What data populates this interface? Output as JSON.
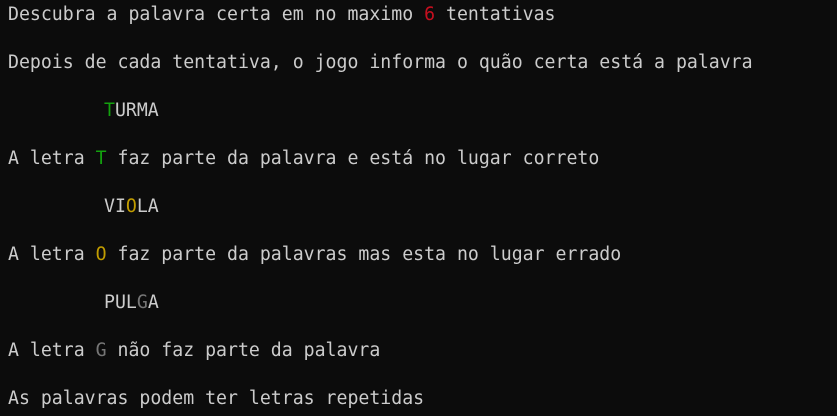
{
  "intro": {
    "line1_before": "Descubra a palavra certa em no maximo ",
    "line1_number": "6",
    "line1_after": " tentativas",
    "line2": "Depois de cada tentativa, o jogo informa o quão certa está a palavra"
  },
  "examples": [
    {
      "word_parts": [
        "",
        "T",
        "URMA"
      ],
      "explanation_before": "A letra ",
      "letter": "T",
      "explanation_after": " faz parte da palavra e está no lugar correto"
    },
    {
      "word_parts": [
        "VI",
        "O",
        "LA"
      ],
      "explanation_before": "A letra ",
      "letter": "O",
      "explanation_after": " faz parte da palavras mas esta no lugar errado"
    },
    {
      "word_parts": [
        "PUL",
        "G",
        "A"
      ],
      "explanation_before": "A letra ",
      "letter": "G",
      "explanation_after": " não faz parte da palavra"
    }
  ],
  "footer": "As palavras podem ter letras repetidas",
  "colors": {
    "background": "#0c0c0c",
    "text": "#cccccc",
    "attempts_number": "#c50f1f",
    "correct_place": "#13a10e",
    "wrong_place": "#c19c00",
    "not_in_word": "#767676"
  }
}
